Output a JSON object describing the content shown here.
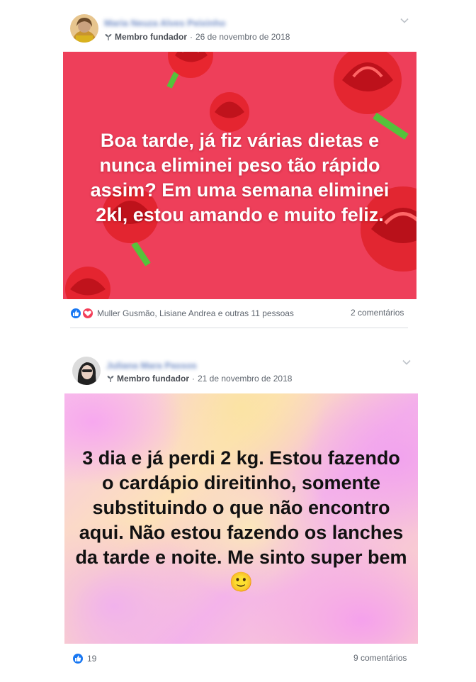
{
  "posts": [
    {
      "author": "Maria Neuza Alves Peixinho",
      "badge": "Membro fundador",
      "date": "26 de novembro de 2018",
      "photo_text": "Boa tarde, já fiz várias dietas e nunca eliminei peso tão rápido assim? Em uma semana eliminei 2kl, estou amando e muito feliz.",
      "reactions_text": "Muller Gusmão, Lisiane Andrea e outras 11 pessoas",
      "comments": "2 comentários",
      "colors": {
        "background": "#ee3f5a",
        "text": "#ffffff"
      }
    },
    {
      "author": "Juliana Mara Passos",
      "badge": "Membro fundador",
      "date": "21 de novembro de 2018",
      "photo_text": "3 dia e já perdi 2 kg. Estou fazendo o cardápio direitinho, somente substituindo o que não encontro aqui. Não estou fazendo os lanches da tarde e noite. Me sinto super bem 🙂",
      "reactions_count": "19",
      "comments": "9 comentários",
      "colors": {
        "text": "#111111"
      }
    }
  ],
  "icons": {
    "sprout": "sprout-icon",
    "chevron": "chevron-down-icon",
    "like": "like-icon",
    "love": "love-icon"
  },
  "separator": "·",
  "accent": "#4267b2"
}
